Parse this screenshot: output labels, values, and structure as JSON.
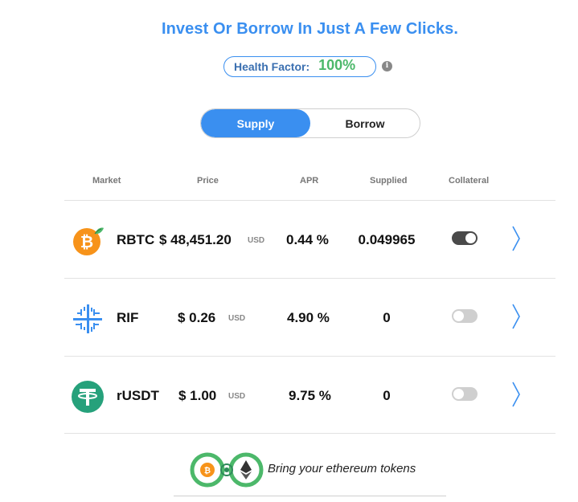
{
  "header": {
    "title": "Invest Or Borrow In Just A Few Clicks."
  },
  "health": {
    "label": "Health Factor:",
    "value": "100%"
  },
  "tabs": [
    {
      "label": "Supply",
      "active": true
    },
    {
      "label": "Borrow",
      "active": false
    }
  ],
  "table": {
    "columns": [
      "Market",
      "Price",
      "APR",
      "Supplied",
      "Collateral"
    ],
    "rows": [
      {
        "name": "RBTC",
        "price": "$ 48,451.20",
        "currency": "USD",
        "apr": "0.44 %",
        "supplied": "0.049965",
        "collateral": true,
        "icon": "rbtc-icon"
      },
      {
        "name": "RIF",
        "price": "$ 0.26",
        "currency": "USD",
        "apr": "4.90 %",
        "supplied": "0",
        "collateral": false,
        "icon": "rif-icon"
      },
      {
        "name": "rUSDT",
        "price": "$ 1.00",
        "currency": "USD",
        "apr": "9.75 %",
        "supplied": "0",
        "collateral": false,
        "icon": "rusdt-icon"
      }
    ]
  },
  "bridge": {
    "text": "Bring your ethereum tokens",
    "icon": "token-bridge-icon"
  },
  "colors": {
    "accent": "#3a8ff0",
    "health_value": "#4cb86a",
    "rbtc": "#f7931a",
    "rusdt": "#26a17b"
  }
}
